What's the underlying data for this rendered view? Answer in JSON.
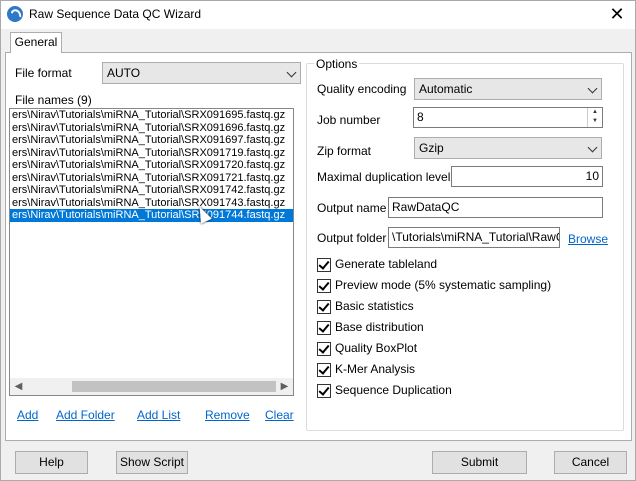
{
  "window": {
    "title": "Raw Sequence Data QC Wizard",
    "close_glyph": "✕"
  },
  "tabs": [
    {
      "label": "General"
    }
  ],
  "left": {
    "file_format_label": "File format",
    "file_format_value": "AUTO",
    "file_names_label": "File names (9)",
    "files": [
      "ers\\Nirav\\Tutorials\\miRNA_Tutorial\\SRX091695.fastq.gz",
      "ers\\Nirav\\Tutorials\\miRNA_Tutorial\\SRX091696.fastq.gz",
      "ers\\Nirav\\Tutorials\\miRNA_Tutorial\\SRX091697.fastq.gz",
      "ers\\Nirav\\Tutorials\\miRNA_Tutorial\\SRX091719.fastq.gz",
      "ers\\Nirav\\Tutorials\\miRNA_Tutorial\\SRX091720.fastq.gz",
      "ers\\Nirav\\Tutorials\\miRNA_Tutorial\\SRX091721.fastq.gz",
      "ers\\Nirav\\Tutorials\\miRNA_Tutorial\\SRX091742.fastq.gz",
      "ers\\Nirav\\Tutorials\\miRNA_Tutorial\\SRX091743.fastq.gz",
      "ers\\Nirav\\Tutorials\\miRNA_Tutorial\\SRX091744.fastq.gz"
    ],
    "selected_file_index": 8,
    "links": {
      "add": "Add",
      "add_folder": "Add Folder",
      "add_list": "Add List",
      "remove": "Remove",
      "clear": "Clear"
    }
  },
  "options": {
    "group_title": "Options",
    "quality_encoding_label": "Quality encoding",
    "quality_encoding_value": "Automatic",
    "job_number_label": "Job number",
    "job_number_value": "8",
    "zip_format_label": "Zip format",
    "zip_format_value": "Gzip",
    "max_dup_label": "Maximal duplication level",
    "max_dup_value": "10",
    "output_name_label": "Output name",
    "output_name_value": "RawDataQC",
    "output_folder_label": "Output folder",
    "output_folder_value": "\\Tutorials\\miRNA_Tutorial\\RawQC",
    "browse_label": "Browse",
    "checkboxes": [
      {
        "label": "Generate tableland",
        "checked": true
      },
      {
        "label": "Preview mode (5% systematic sampling)",
        "checked": true
      },
      {
        "label": "Basic statistics",
        "checked": true
      },
      {
        "label": "Base distribution",
        "checked": true
      },
      {
        "label": "Quality BoxPlot",
        "checked": true
      },
      {
        "label": "K-Mer Analysis",
        "checked": true
      },
      {
        "label": "Sequence Duplication",
        "checked": true
      }
    ]
  },
  "footer": {
    "help": "Help",
    "show_script": "Show Script",
    "submit": "Submit",
    "cancel": "Cancel"
  }
}
